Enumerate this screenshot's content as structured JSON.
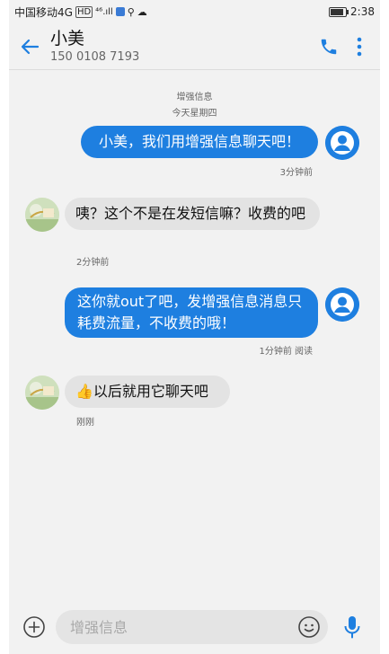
{
  "status_bar": {
    "carrier": "中国移动4G",
    "hd": "HD",
    "network": "⁴⁶.ıll",
    "time": "2:38"
  },
  "header": {
    "contact_name": "小美",
    "contact_phone": "150 0108 7193"
  },
  "conversation": {
    "channel_label": "增强信息",
    "date_label": "今天星期四",
    "messages": [
      {
        "direction": "outgoing",
        "text": "小美，我们用增强信息聊天吧！",
        "meta": "3分钟前"
      },
      {
        "direction": "incoming",
        "text": "咦？这个不是在发短信嘛？收费的吧",
        "meta": "2分钟前"
      },
      {
        "direction": "outgoing",
        "text": "这你就out了吧，发增强信息消息只耗费流量，不收费的哦！",
        "meta": "1分钟前 阅读"
      },
      {
        "direction": "incoming",
        "text": "👍以后就用它聊天吧",
        "meta": "刚刚"
      }
    ]
  },
  "composer": {
    "placeholder": "增强信息"
  },
  "colors": {
    "accent": "#1e7fe0",
    "incoming_bubble": "#e3e3e3",
    "background": "#f2f2f2"
  },
  "icons": {
    "back": "arrow-left-icon",
    "call": "phone-icon",
    "menu": "more-vertical-icon",
    "add": "add-circle-icon",
    "emoji": "smiley-icon",
    "mic": "microphone-icon"
  }
}
